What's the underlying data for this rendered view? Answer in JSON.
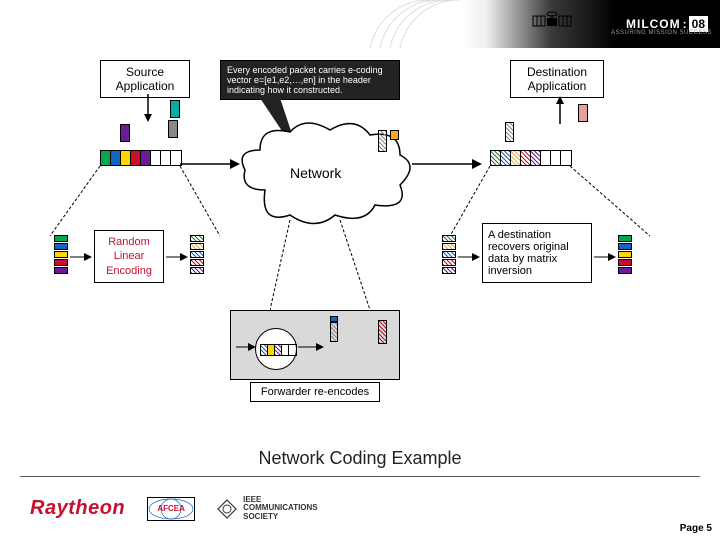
{
  "header": {
    "brand": "MILCOM",
    "year": "08",
    "tagline": "ASSURING MISSION SUCCESS"
  },
  "diagram": {
    "source_box": "Source\nApplication",
    "encoding_callout": "Every encoded packet carries e-coding vector e=[e1,e2,…,en] in the header indicating how it constructed.",
    "network_label": "Network",
    "destination_box": "Destination\nApplication",
    "random_linear": "Random\nLinear\nEncoding",
    "destination_recover": "A destination recovers original data by matrix inversion",
    "forwarder_label": "Forwarder re-encodes",
    "source_colors": [
      "#00a651",
      "#1565c0",
      "#ffd600",
      "#c8102e",
      "#6a1b9a"
    ],
    "encoded_stack_classes": [
      "hatchG",
      "hatchY",
      "hatchB",
      "hatchR",
      "hatchP"
    ],
    "dest_colors": [
      "#00a651",
      "#1565c0",
      "#ffd600",
      "#c8102e",
      "#6a1b9a"
    ]
  },
  "caption": "Network Coding Example",
  "footer": {
    "raytheon": "Raytheon",
    "afcea": "AFCEA",
    "ieee_line1": "IEEE",
    "ieee_line2": "COMMUNICATIONS",
    "ieee_line3": "SOCIETY",
    "page": "Page 5"
  }
}
